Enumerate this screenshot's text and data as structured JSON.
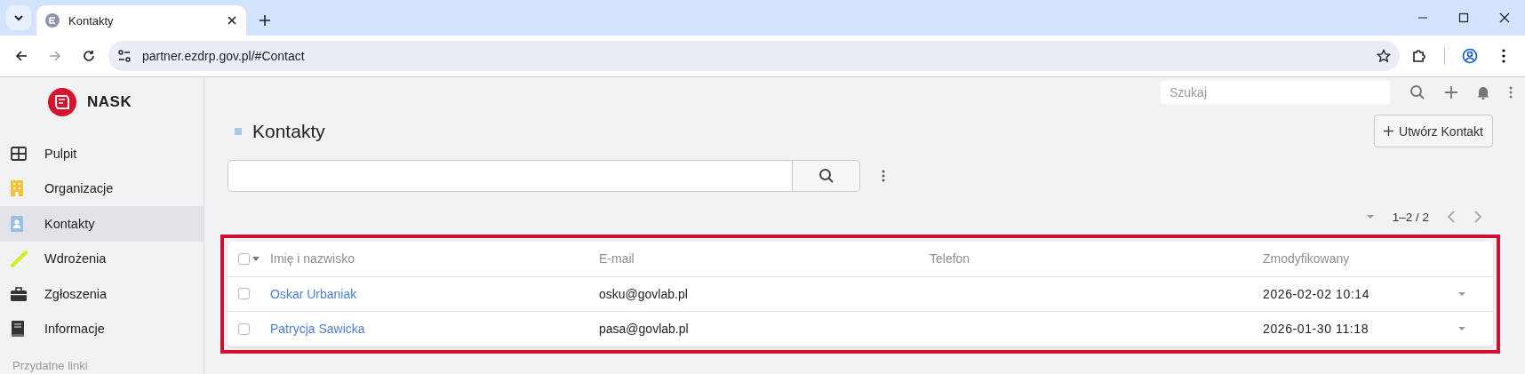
{
  "browser": {
    "tabs": [
      {
        "title": "Kontakty",
        "selected": true
      }
    ],
    "url": "partner.ezdrp.gov.pl/#Contact"
  },
  "sidebar": {
    "logo": "NASK",
    "items": [
      {
        "label": "Pulpit",
        "selected": false
      },
      {
        "label": "Organizacje",
        "selected": false
      },
      {
        "label": "Kontakty",
        "selected": true
      },
      {
        "label": "Wdrożenia",
        "selected": false
      },
      {
        "label": "Zgłoszenia",
        "selected": false
      },
      {
        "label": "Informacje",
        "selected": false
      }
    ],
    "section": "Przydatne linki"
  },
  "header": {
    "search": {
      "placeholder": "Szukaj"
    }
  },
  "page": {
    "title": "Kontakty",
    "create_button": "Utwórz Kontakt"
  },
  "pagination": {
    "range": "1–2 / 2"
  },
  "table": {
    "header_checked": false,
    "columns": [
      "Imię i nazwisko",
      "E-mail",
      "Telefon",
      "Zmodyfikowany"
    ],
    "rows": [
      {
        "checked": false,
        "name": "Oskar Urbaniak",
        "email": "osku@govlab.pl",
        "modified": "2026-02-02 10:14"
      },
      {
        "checked": false,
        "name": "Patrycja Sawicka",
        "email": "pasa@govlab.pl",
        "modified": "2026-01-30 11:18"
      }
    ]
  }
}
